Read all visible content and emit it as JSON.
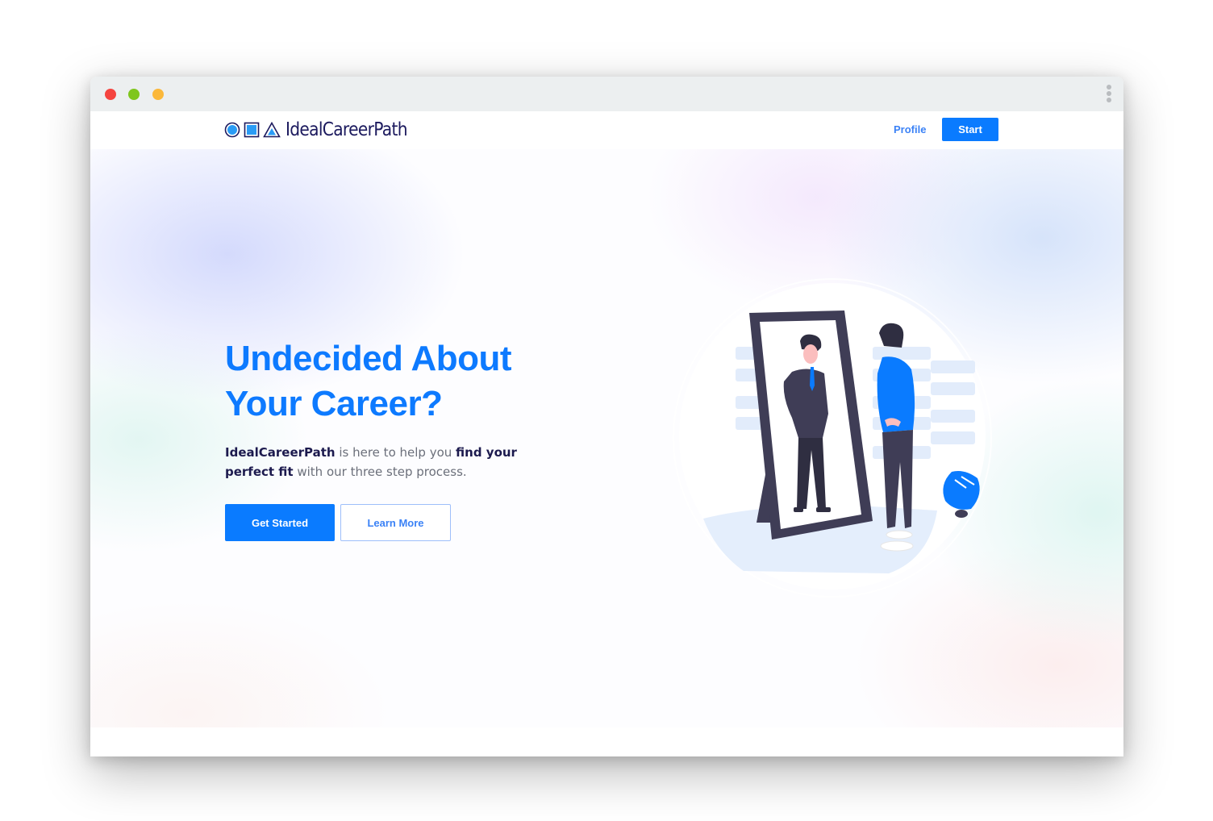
{
  "window": {
    "controls": [
      "close",
      "minimize",
      "maximize"
    ],
    "menu_icon": "kebab-menu-icon"
  },
  "navbar": {
    "logo": {
      "shapes": [
        "circle-icon",
        "square-icon",
        "triangle-icon"
      ],
      "text": "IdealCareerPath"
    },
    "profile_link": "Profile",
    "start_button": "Start"
  },
  "hero": {
    "title_line1": "Undecided About",
    "title_line2": "Your Career?",
    "description": {
      "brand": "IdealCareerPath",
      "part1": " is here to help you ",
      "emphasis": "find your perfect fit",
      "part2": " with our three step process."
    },
    "primary_button": "Get Started",
    "secondary_button": "Learn More",
    "illustration": "person-looking-in-mirror-illustration"
  },
  "colors": {
    "accent": "#0a7bff",
    "brand_text": "#1c1a5e",
    "title": "#0d7aff",
    "link": "#3b82f6"
  }
}
